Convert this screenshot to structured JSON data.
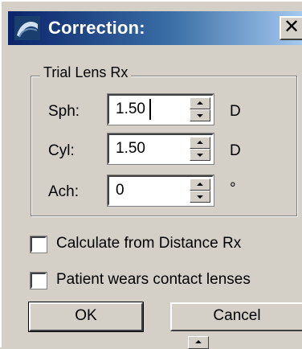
{
  "window": {
    "title": "Correction:",
    "close_label": "✕"
  },
  "trial_lens": {
    "group_label": "Trial Lens Rx",
    "fields": [
      {
        "label": "Sph:",
        "value": "1.50",
        "unit": "D"
      },
      {
        "label": "Cyl:",
        "value": "1.50",
        "unit": "D"
      },
      {
        "label": "Ach:",
        "value": "0",
        "unit": "°"
      }
    ]
  },
  "options": {
    "calculate_from_distance": {
      "label": "Calculate from Distance Rx",
      "checked": false
    },
    "wears_contacts": {
      "label": "Patient wears contact lenses",
      "checked": false
    }
  },
  "buttons": {
    "ok": "OK",
    "cancel": "Cancel"
  }
}
